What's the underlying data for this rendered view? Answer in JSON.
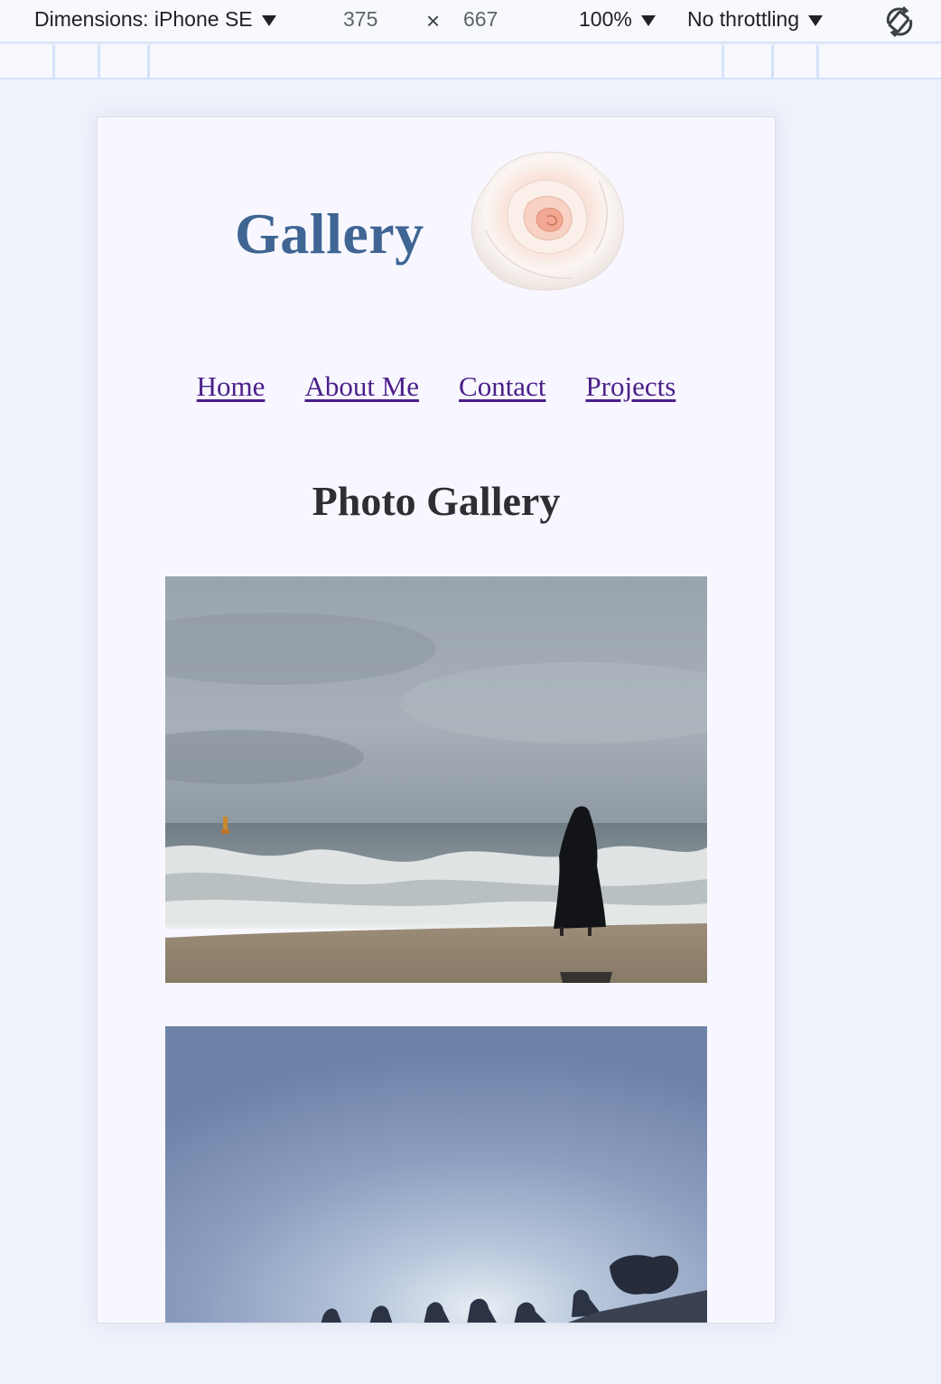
{
  "devtools": {
    "dimensions_label": "Dimensions: iPhone SE",
    "width_value": "375",
    "times_symbol": "×",
    "height_value": "667",
    "zoom_label": "100%",
    "throttling_label": "No throttling",
    "icons": [
      "chevron-down-icon",
      "rotate-icon"
    ]
  },
  "site": {
    "title": "Gallery",
    "logo_icon": "rose-logo",
    "nav": [
      {
        "label": "Home"
      },
      {
        "label": "About Me"
      },
      {
        "label": "Contact"
      },
      {
        "label": "Projects"
      }
    ],
    "heading": "Photo Gallery",
    "colors": {
      "title": "#3f6593",
      "link_visited": "#4b1f8a",
      "heading": "#2f2f33",
      "page_bg": "#f8f7ff"
    }
  }
}
